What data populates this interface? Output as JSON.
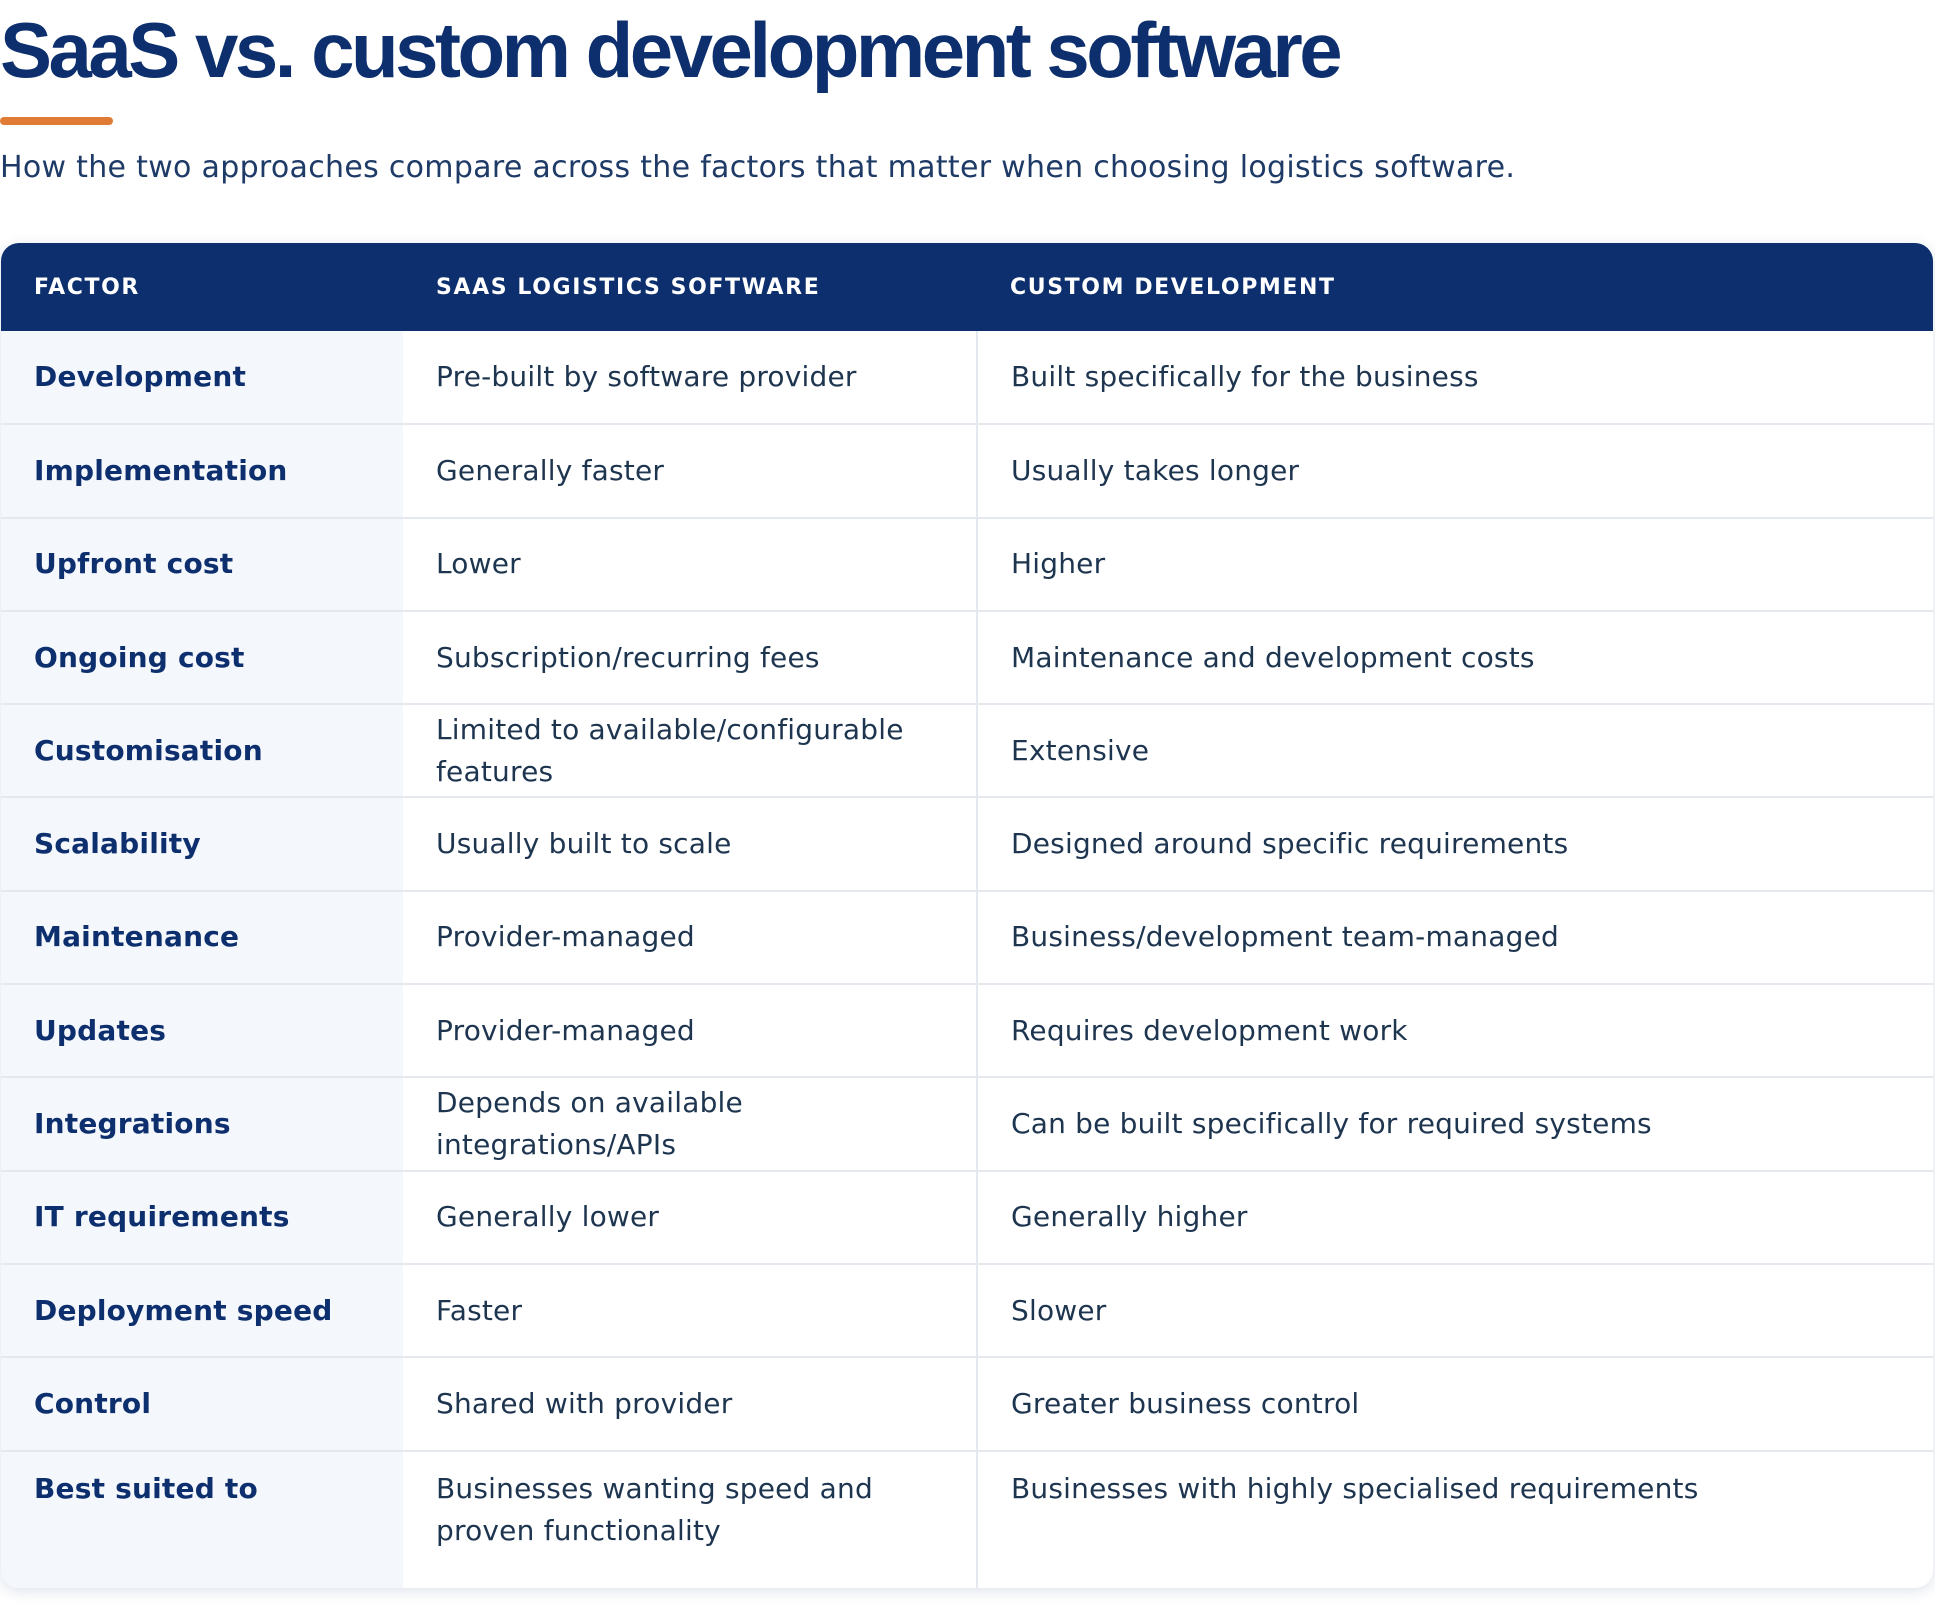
{
  "page": {
    "title": "SaaS vs. custom development software",
    "subtitle": "How the two approaches compare across the factors that matter when choosing logistics software.",
    "accent_color": "#e07b35",
    "brand_color": "#0d2f6e"
  },
  "table": {
    "headers": {
      "factor": "FACTOR",
      "saas": "SAAS LOGISTICS SOFTWARE",
      "custom": "CUSTOM DEVELOPMENT"
    },
    "rows": [
      {
        "factor": "Development",
        "saas": "Pre-built by software provider",
        "custom": "Built specifically for the business"
      },
      {
        "factor": "Implementation",
        "saas": "Generally faster",
        "custom": "Usually takes longer"
      },
      {
        "factor": "Upfront cost",
        "saas": "Lower",
        "custom": "Higher"
      },
      {
        "factor": "Ongoing cost",
        "saas": "Subscription/recurring fees",
        "custom": "Maintenance and development costs"
      },
      {
        "factor": "Customisation",
        "saas": "Limited to available/configurable features",
        "custom": "Extensive"
      },
      {
        "factor": "Scalability",
        "saas": "Usually built to scale",
        "custom": "Designed around specific requirements"
      },
      {
        "factor": "Maintenance",
        "saas": "Provider-managed",
        "custom": "Business/development team-managed"
      },
      {
        "factor": "Updates",
        "saas": "Provider-managed",
        "custom": "Requires development work"
      },
      {
        "factor": "Integrations",
        "saas": "Depends on available integrations/APIs",
        "custom": "Can be built specifically for required systems"
      },
      {
        "factor": "IT requirements",
        "saas": "Generally lower",
        "custom": "Generally higher"
      },
      {
        "factor": "Deployment speed",
        "saas": "Faster",
        "custom": "Slower"
      },
      {
        "factor": "Control",
        "saas": "Shared with provider",
        "custom": "Greater business control"
      },
      {
        "factor": "Best suited to",
        "saas": "Businesses wanting speed and proven functionality",
        "custom": "Businesses with highly specialised requirements"
      }
    ]
  }
}
